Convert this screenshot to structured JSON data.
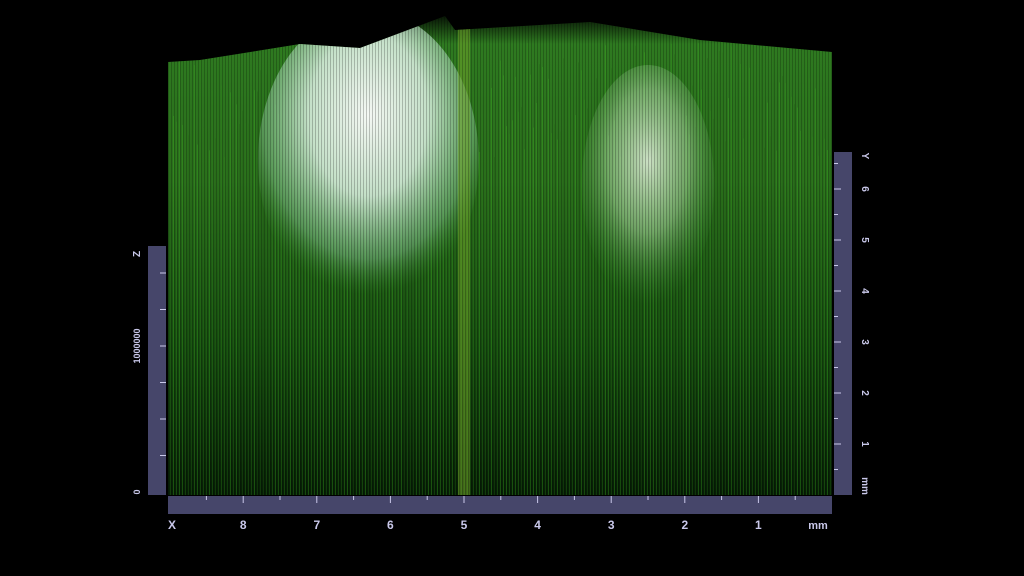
{
  "chart_data": {
    "type": "surface3d",
    "title": "",
    "colors": {
      "background": "#000000",
      "surface_low": "#0b2a08",
      "surface_mid": "#2f7a1e",
      "surface_high": "#f2fbf1",
      "axis_bar": "#46466a",
      "axis_text": "#c9c8ea"
    },
    "x_axis": {
      "name": "X",
      "unit": "mm",
      "ticks": [
        "8",
        "7",
        "6",
        "5",
        "4",
        "3",
        "2",
        "1"
      ],
      "tick_values": [
        8,
        7,
        6,
        5,
        4,
        3,
        2,
        1
      ],
      "range": [
        0,
        9
      ],
      "reversed": true
    },
    "y_axis": {
      "name": "Y",
      "unit": "mm",
      "ticks": [
        "6",
        "5",
        "4",
        "3",
        "2",
        "1"
      ],
      "tick_values": [
        6,
        5,
        4,
        3,
        2,
        1
      ],
      "range": [
        0,
        6.8
      ]
    },
    "z_axis": {
      "name": "Z",
      "ticks": [
        "1000000",
        "0"
      ],
      "tick_values": [
        1000000,
        0
      ],
      "range": [
        0,
        2000000
      ]
    },
    "features": [
      {
        "kind": "peak",
        "x_mm": 6.3,
        "height": 1.0,
        "x_half_width_mm": 1.5
      },
      {
        "kind": "peak",
        "x_mm": 2.5,
        "height": 0.55,
        "x_half_width_mm": 0.9
      },
      {
        "kind": "ridge",
        "x_mm": 5.0,
        "height": 0.4
      }
    ]
  }
}
